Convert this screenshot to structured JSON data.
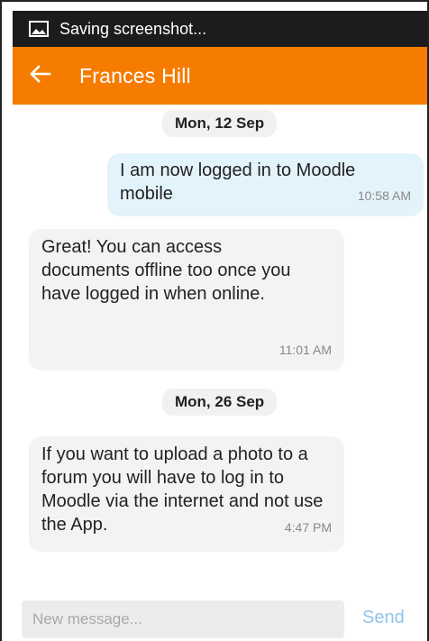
{
  "status_bar": {
    "icon": "image-icon",
    "text": "Saving screenshot..."
  },
  "app_bar": {
    "back_icon": "arrow-left-icon",
    "title": "Frances Hill",
    "accent_color": "#f57c00"
  },
  "conversation": {
    "groups": [
      {
        "date": "Mon, 12 Sep",
        "messages": [
          {
            "direction": "sent",
            "text": "I am now logged in to Moodle mobile",
            "time": "10:58 AM"
          },
          {
            "direction": "received",
            "text": "Great! You can access documents offline too once you have logged in when online.",
            "time": "11:01 AM"
          }
        ]
      },
      {
        "date": "Mon, 26 Sep",
        "messages": [
          {
            "direction": "received",
            "text": "If you want to upload a photo to a forum you will have to log in to Moodle via the internet and not use the App.",
            "time": "4:47 PM"
          }
        ]
      }
    ]
  },
  "composer": {
    "placeholder": "New message...",
    "send_label": "Send"
  }
}
